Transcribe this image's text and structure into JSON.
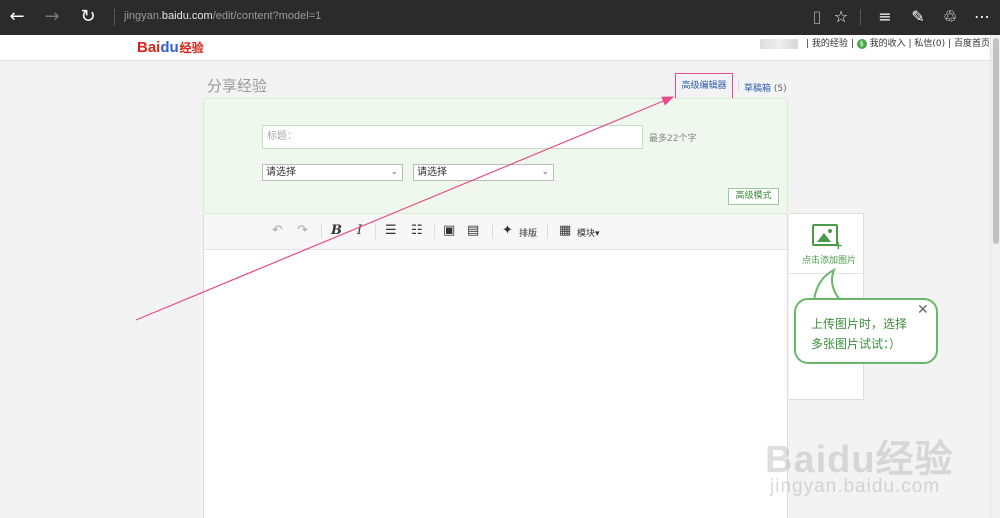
{
  "browser": {
    "back_icon": "back-arrow-icon",
    "forward_icon": "forward-arrow-icon",
    "refresh_icon": "refresh-icon",
    "url_prefix": "jingyan.",
    "url_domain": "baidu.com",
    "url_path": "/edit/content?model=1",
    "toolbar_icons": [
      "reading-view-icon",
      "favorite-star-icon",
      "hub-icon",
      "web-note-icon",
      "share-icon",
      "more-icon"
    ]
  },
  "header": {
    "logo_text": "Bai",
    "logo_paw": "du",
    "logo_suffix": "经验",
    "links": {
      "my_jingyan": "我的经验",
      "my_income": "我的收入",
      "messages": "私信(0)",
      "home": "百度首页",
      "divider": "|"
    }
  },
  "page": {
    "title": "分享经验",
    "advanced_editor": "高级编辑器",
    "drafts_label": "草稿箱",
    "drafts_count": "(5)",
    "pipe": "|"
  },
  "form": {
    "title_placeholder": "标题：",
    "limit_hint": "最多22个字",
    "select1": "请选择",
    "select2": "请选择",
    "advanced_mode": "高级模式"
  },
  "editor_toolbar": {
    "layout_label": "排版",
    "module_label": "模块"
  },
  "side": {
    "add_image_label": "点击添加图片"
  },
  "bubble": {
    "line1": "上传图片时，选择",
    "line2": "多张图片试试：）",
    "close": "✕"
  },
  "watermark": {
    "main": "Baidu经验",
    "sub": "jingyan.baidu.com"
  },
  "colors": {
    "annotation_arrow": "#e64b8a",
    "green_accent": "#4a9a4a",
    "link_blue": "#2a5fb0"
  }
}
